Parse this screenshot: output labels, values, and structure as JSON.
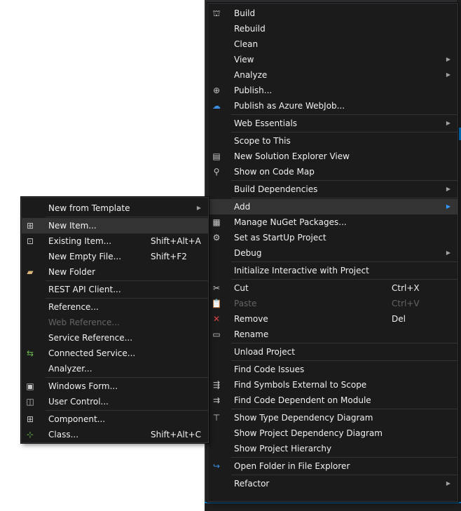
{
  "main_menu": {
    "groups": [
      [
        {
          "label": "Build",
          "icon": "build-icon",
          "glyph": "⛫"
        },
        {
          "label": "Rebuild"
        },
        {
          "label": "Clean"
        },
        {
          "label": "View",
          "submenu": true
        },
        {
          "label": "Analyze",
          "submenu": true
        },
        {
          "label": "Publish...",
          "icon": "publish-icon",
          "glyph": "⊕"
        },
        {
          "label": "Publish as Azure WebJob...",
          "icon": "azure-cloud-icon",
          "glyph": "☁",
          "color": "blue"
        }
      ],
      [
        {
          "label": "Web Essentials",
          "submenu": true
        }
      ],
      [
        {
          "label": "Scope to This"
        },
        {
          "label": "New Solution Explorer View",
          "icon": "solution-explorer-icon",
          "glyph": "▤"
        },
        {
          "label": "Show on Code Map",
          "icon": "code-map-icon",
          "glyph": "⚲"
        }
      ],
      [
        {
          "label": "Build Dependencies",
          "submenu": true
        }
      ],
      [
        {
          "label": "Add",
          "submenu": true,
          "highlighted": true
        },
        {
          "label": "Manage NuGet Packages...",
          "icon": "nuget-icon",
          "glyph": "▦"
        },
        {
          "label": "Set as StartUp Project",
          "icon": "gear-icon",
          "glyph": "⚙"
        },
        {
          "label": "Debug",
          "submenu": true
        }
      ],
      [
        {
          "label": "Initialize Interactive with Project"
        }
      ],
      [
        {
          "label": "Cut",
          "shortcut": "Ctrl+X",
          "icon": "scissors-icon",
          "glyph": "✂"
        },
        {
          "label": "Paste",
          "shortcut": "Ctrl+V",
          "disabled": true,
          "icon": "paste-icon",
          "glyph": "📋"
        },
        {
          "label": "Remove",
          "shortcut": "Del",
          "icon": "remove-icon",
          "glyph": "✕",
          "color": "red"
        },
        {
          "label": "Rename",
          "icon": "rename-icon",
          "glyph": "▭"
        }
      ],
      [
        {
          "label": "Unload Project"
        }
      ],
      [
        {
          "label": "Find Code Issues"
        },
        {
          "label": "Find Symbols External to Scope",
          "icon": "find-symbols-icon",
          "glyph": "⇶"
        },
        {
          "label": "Find Code Dependent on Module",
          "icon": "find-dependent-icon",
          "glyph": "⇉"
        }
      ],
      [
        {
          "label": "Show Type Dependency Diagram",
          "icon": "type-diagram-icon",
          "glyph": "⊤"
        },
        {
          "label": "Show Project Dependency Diagram"
        },
        {
          "label": "Show Project Hierarchy"
        }
      ],
      [
        {
          "label": "Open Folder in File Explorer",
          "icon": "open-folder-icon",
          "glyph": "↪",
          "color": "blue"
        }
      ],
      [
        {
          "label": "Refactor",
          "submenu": true
        }
      ]
    ]
  },
  "add_submenu": {
    "groups": [
      [
        {
          "label": "New from Template",
          "submenu": true
        }
      ],
      [
        {
          "label": "New Item...",
          "highlighted": true,
          "icon": "new-item-icon",
          "glyph": "⊞"
        },
        {
          "label": "Existing Item...",
          "shortcut": "Shift+Alt+A",
          "icon": "existing-item-icon",
          "glyph": "⊡"
        },
        {
          "label": "New Empty File...",
          "shortcut": "Shift+F2"
        },
        {
          "label": "New Folder",
          "icon": "new-folder-icon",
          "glyph": "▰",
          "color": "yellow"
        }
      ],
      [
        {
          "label": "REST API Client..."
        }
      ],
      [
        {
          "label": "Reference..."
        },
        {
          "label": "Web Reference...",
          "disabled": true
        },
        {
          "label": "Service Reference..."
        },
        {
          "label": "Connected Service...",
          "icon": "connected-service-icon",
          "glyph": "⇆",
          "color": "green"
        },
        {
          "label": "Analyzer..."
        }
      ],
      [
        {
          "label": "Windows Form...",
          "icon": "windows-form-icon",
          "glyph": "▣"
        },
        {
          "label": "User Control...",
          "icon": "user-control-icon",
          "glyph": "◫"
        }
      ],
      [
        {
          "label": "Component...",
          "icon": "component-icon",
          "glyph": "⊞"
        },
        {
          "label": "Class...",
          "shortcut": "Shift+Alt+C",
          "icon": "class-icon",
          "glyph": "⊹",
          "color": "green"
        }
      ]
    ]
  }
}
